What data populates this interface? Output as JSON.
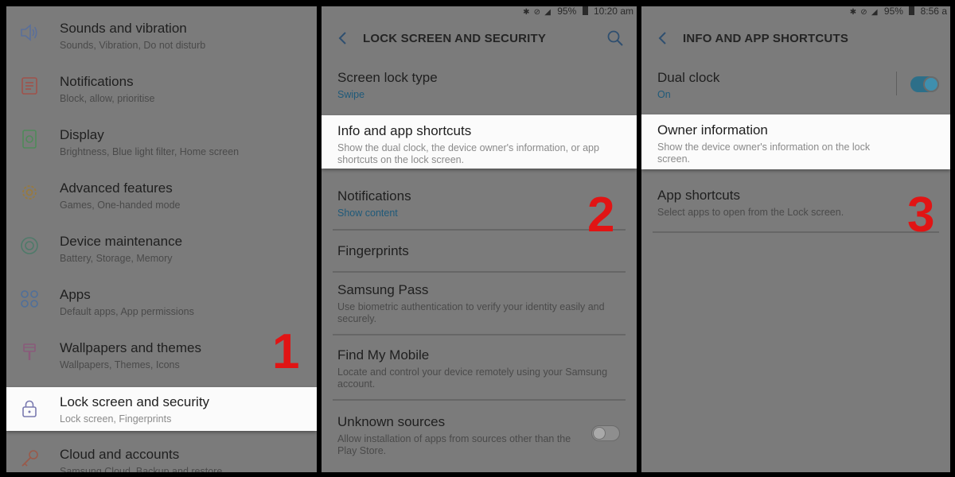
{
  "panel1": {
    "items": [
      {
        "title": "Sounds and vibration",
        "subtitle": "Sounds, Vibration, Do not disturb",
        "icon": "speaker-icon"
      },
      {
        "title": "Notifications",
        "subtitle": "Block, allow, prioritise",
        "icon": "notifications-icon"
      },
      {
        "title": "Display",
        "subtitle": "Brightness, Blue light filter, Home screen",
        "icon": "display-icon"
      },
      {
        "title": "Advanced features",
        "subtitle": "Games, One-handed mode",
        "icon": "gear-icon"
      },
      {
        "title": "Device maintenance",
        "subtitle": "Battery, Storage, Memory",
        "icon": "maintenance-icon"
      },
      {
        "title": "Apps",
        "subtitle": "Default apps, App permissions",
        "icon": "apps-icon"
      },
      {
        "title": "Wallpapers and themes",
        "subtitle": "Wallpapers, Themes, Icons",
        "icon": "brush-icon"
      },
      {
        "title": "Lock screen and security",
        "subtitle": "Lock screen, Fingerprints",
        "icon": "lock-icon"
      },
      {
        "title": "Cloud and accounts",
        "subtitle": "Samsung Cloud, Backup and restore",
        "icon": "key-icon"
      }
    ],
    "step": "1"
  },
  "panel2": {
    "status": {
      "icons": "✱ ⊘ ◢",
      "battery": "95%",
      "time": "10:20 am"
    },
    "title": "LOCK SCREEN AND SECURITY",
    "items": [
      {
        "title": "Screen lock type",
        "subtitle": "Swipe"
      },
      {
        "title": "Info and app shortcuts",
        "subtitle": "Show the dual clock, the device owner's information, or app shortcuts on the lock screen."
      },
      {
        "title": "Notifications",
        "subtitle": "Show content"
      },
      {
        "title": "Fingerprints",
        "subtitle": ""
      },
      {
        "title": "Samsung Pass",
        "subtitle": "Use biometric authentication to verify your identity easily and securely."
      },
      {
        "title": "Find My Mobile",
        "subtitle": "Locate and control your device remotely using your Samsung account."
      },
      {
        "title": "Unknown sources",
        "subtitle": "Allow installation of apps from sources other than the Play Store."
      }
    ],
    "step": "2"
  },
  "panel3": {
    "status": {
      "icons": "✱ ⊘ ◢",
      "battery": "95%",
      "time": "8:56 a"
    },
    "title": "INFO AND APP SHORTCUTS",
    "items": [
      {
        "title": "Dual clock",
        "subtitle": "On"
      },
      {
        "title": "Owner information",
        "subtitle": "Show the device owner's information on the lock screen."
      },
      {
        "title": "App shortcuts",
        "subtitle": "Select apps to open from the Lock screen."
      }
    ],
    "step": "3"
  }
}
